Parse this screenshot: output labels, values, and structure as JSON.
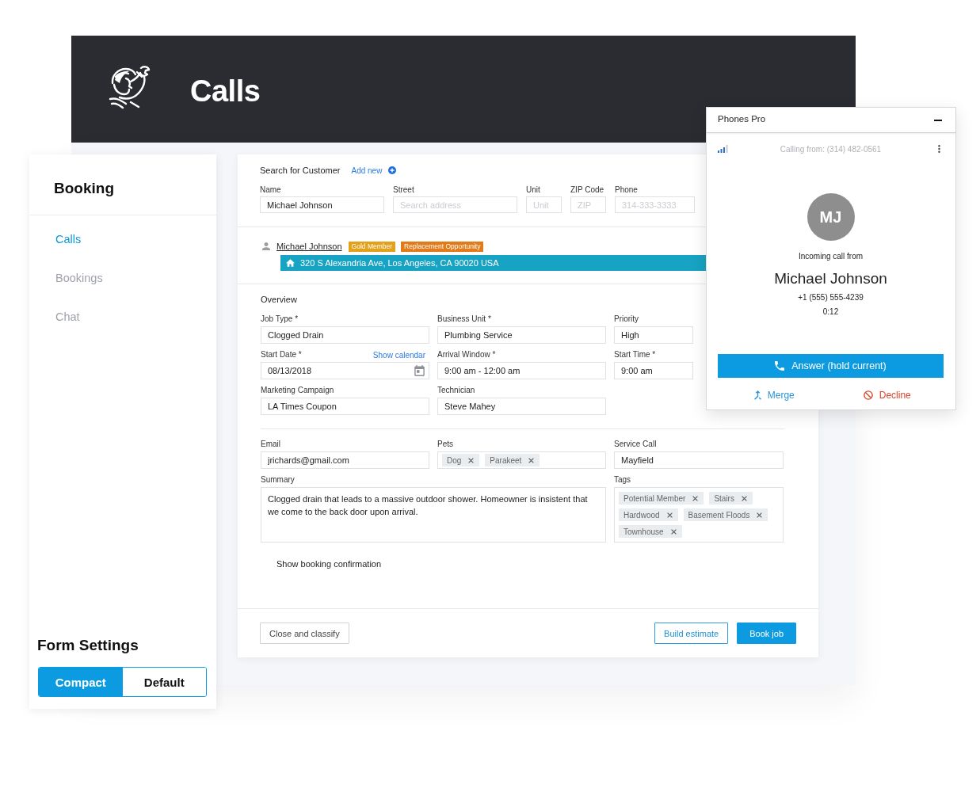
{
  "header": {
    "title": "Calls"
  },
  "sidebar": {
    "title": "Booking",
    "items": [
      {
        "label": "Calls",
        "selected": true
      },
      {
        "label": "Bookings",
        "selected": false
      },
      {
        "label": "Chat",
        "selected": false
      }
    ],
    "form_settings": {
      "title": "Form Settings",
      "options": [
        {
          "label": "Compact",
          "selected": true
        },
        {
          "label": "Default",
          "selected": false
        }
      ]
    }
  },
  "customer_search": {
    "title": "Search for Customer",
    "add_link": "Add new",
    "fields": [
      {
        "label": "Name",
        "value": "Michael Johnson"
      },
      {
        "label": "Street",
        "placeholder": "Search address"
      },
      {
        "label": "Unit",
        "placeholder": "Unit"
      },
      {
        "label": "ZIP Code",
        "placeholder": "ZIP"
      },
      {
        "label": "Phone",
        "placeholder": "314-333-3333"
      }
    ]
  },
  "customer": {
    "name": "Michael Johnson",
    "badges": [
      {
        "label": "Gold Member",
        "color": "#e3a019"
      },
      {
        "label": "Replacement Opportunity",
        "color": "#e27a17"
      }
    ],
    "address": "320 S Alexandria Ave, Los Angeles, CA 90020 USA"
  },
  "overview": {
    "title": "Overview",
    "rows": [
      [
        {
          "kind": "text",
          "label": "Job Type *",
          "value": "Clogged Drain"
        },
        {
          "kind": "text",
          "label": "Business Unit *",
          "value": "Plumbing Service"
        },
        {
          "kind": "text",
          "label": "Priority",
          "value": "High"
        }
      ],
      [
        {
          "kind": "date",
          "label": "Start Date *",
          "link": "Show calendar",
          "value": "08/13/2018"
        },
        {
          "kind": "text",
          "label": "Arrival Window *",
          "value": "9:00 am - 12:00 am"
        },
        {
          "kind": "text",
          "label": "Start Time *",
          "value": "9:00 am"
        }
      ],
      [
        {
          "kind": "text",
          "label": "Marketing Campaign",
          "value": "LA Times Coupon"
        },
        {
          "kind": "text",
          "label": "Technician",
          "value": "Steve Mahey"
        }
      ]
    ]
  },
  "details": {
    "fields": [
      {
        "kind": "text",
        "label": "Email",
        "value": "jrichards@gmail.com"
      },
      {
        "kind": "chips",
        "label": "Pets",
        "chips": [
          "Dog",
          "Parakeet"
        ]
      },
      {
        "kind": "text",
        "label": "Service Call",
        "value": "Mayfield"
      },
      {
        "kind": "textarea",
        "label": "Summary",
        "value": "Clogged drain that leads to a massive outdoor shower. Homeowner is insistent that we come to the back door upon arrival."
      },
      {
        "kind": "chips",
        "label": "Tags",
        "chips": [
          "Potential Member",
          "Stairs",
          "Hardwood",
          "Basement Floods",
          "Townhouse"
        ]
      }
    ]
  },
  "confirmation_label": "Show booking confirmation",
  "footer_buttons": [
    {
      "kind": "secondary",
      "label": "Close and classify"
    },
    {
      "kind": "outline",
      "label": "Build estimate"
    },
    {
      "kind": "primary",
      "label": "Book job"
    }
  ],
  "phone_panel": {
    "title": "Phones Pro",
    "calling_from": "Calling from: (314) 482-0561",
    "avatar_initials": "MJ",
    "status": "Incoming call from",
    "caller_name": "Michael Johnson",
    "caller_number": "+1 (555) 555-4239",
    "duration": "0:12",
    "answer_button": "Answer (hold current)",
    "actions": [
      {
        "kind": "merge",
        "label": "Merge"
      },
      {
        "kind": "decline",
        "label": "Decline"
      }
    ]
  }
}
